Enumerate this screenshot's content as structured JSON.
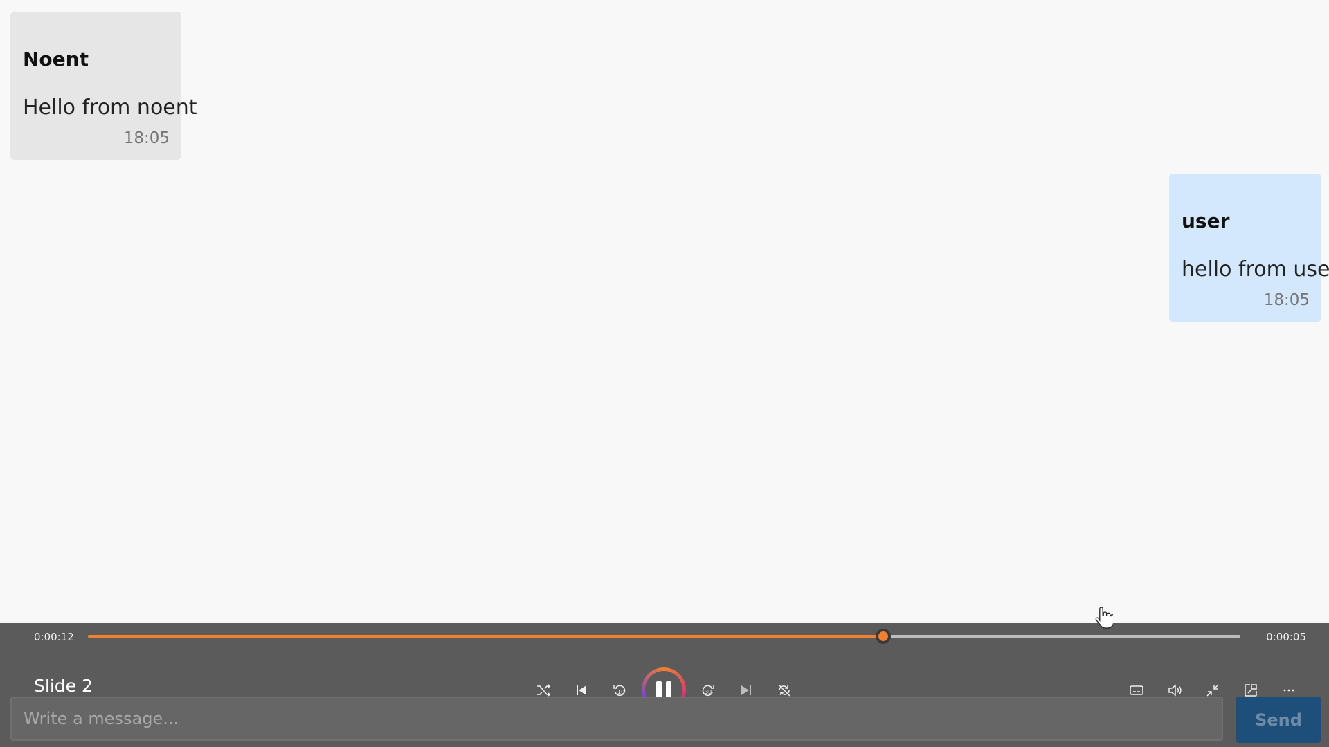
{
  "messages": [
    {
      "sender": "Noent",
      "text": "Hello from noent",
      "time": "18:05",
      "direction": "incoming"
    },
    {
      "sender": "user",
      "text": "hello from user",
      "time": "18:05",
      "direction": "outgoing"
    }
  ],
  "player": {
    "elapsed": "0:00:12",
    "remaining": "0:00:05",
    "progress": 0.69,
    "title": "Slide 2",
    "state": "playing",
    "controls": [
      "shuffle-icon",
      "previous-icon",
      "rewind-10-icon",
      "pause-icon",
      "forward-30-icon",
      "next-icon",
      "repeat-off-icon"
    ],
    "right_controls": [
      "captions-icon",
      "volume-icon",
      "exit-fullscreen-icon",
      "miniplayer-icon",
      "more-icon"
    ],
    "accent": "#f08030"
  },
  "composer": {
    "placeholder": "Write a message...",
    "send_label": "Send"
  }
}
